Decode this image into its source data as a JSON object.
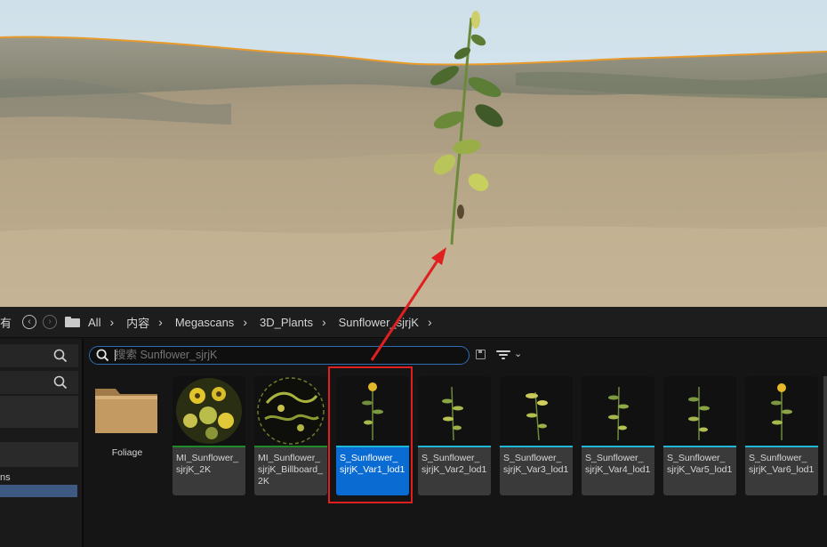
{
  "path_bar": {
    "lead_fragment": "有",
    "crumbs": [
      "All",
      "内容",
      "Megascans",
      "3D_Plants",
      "Sunflower_sjrjK"
    ]
  },
  "left_panel": {
    "partial_item_text": "ns"
  },
  "search": {
    "placeholder": "搜索 Sunflower_sjrjK"
  },
  "assets": [
    {
      "label": "Foliage",
      "kind": "folder"
    },
    {
      "label": "MI_Sunflower_\nsjrjK_2K",
      "kind": "material",
      "strip_color": "#1e8a2a"
    },
    {
      "label": "MI_Sunflower_\nsjrjK_Billboard_\n2K",
      "kind": "material",
      "strip_color": "#1e8a2a"
    },
    {
      "label": "S_Sunflower_\nsjrjK_Var1_lod1",
      "kind": "static-mesh",
      "strip_color": "#1fb7d6",
      "selected": true
    },
    {
      "label": "S_Sunflower_\nsjrjK_Var2_lod1",
      "kind": "static-mesh",
      "strip_color": "#1fb7d6"
    },
    {
      "label": "S_Sunflower_\nsjrjK_Var3_lod1",
      "kind": "static-mesh",
      "strip_color": "#1fb7d6"
    },
    {
      "label": "S_Sunflower_\nsjrjK_Var4_lod1",
      "kind": "static-mesh",
      "strip_color": "#1fb7d6"
    },
    {
      "label": "S_Sunflower_\nsjrjK_Var5_lod1",
      "kind": "static-mesh",
      "strip_color": "#1fb7d6"
    },
    {
      "label": "S_Sunflower_\nsjrjK_Var6_lod1",
      "kind": "static-mesh",
      "strip_color": "#1fb7d6"
    }
  ],
  "colors": {
    "selection": "#0a6bd3",
    "annotation": "#e02020",
    "search_border": "#2f6db5"
  }
}
